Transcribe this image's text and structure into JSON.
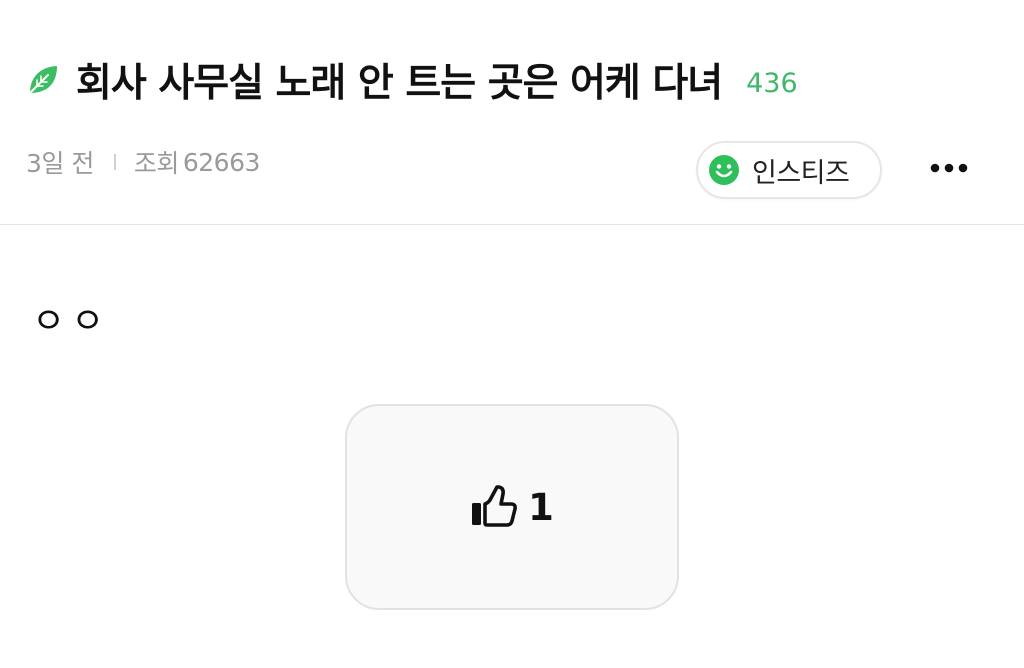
{
  "post": {
    "category_icon": "leaf-icon",
    "title": "회사 사무실 노래 안 트는 곳은 어케 다녀",
    "comment_count": "436",
    "comment_count_color": "#3fb86a",
    "time_ago": "3일 전",
    "views_label": "조회",
    "views_value": "62663",
    "body": "ㅇㅇ"
  },
  "board_chip": {
    "icon": "smile-icon",
    "icon_color": "#2fbf5a",
    "label": "인스티즈"
  },
  "more_menu": {
    "icon": "more-dots-icon"
  },
  "like": {
    "icon": "thumbs-up-icon",
    "count": "1"
  }
}
